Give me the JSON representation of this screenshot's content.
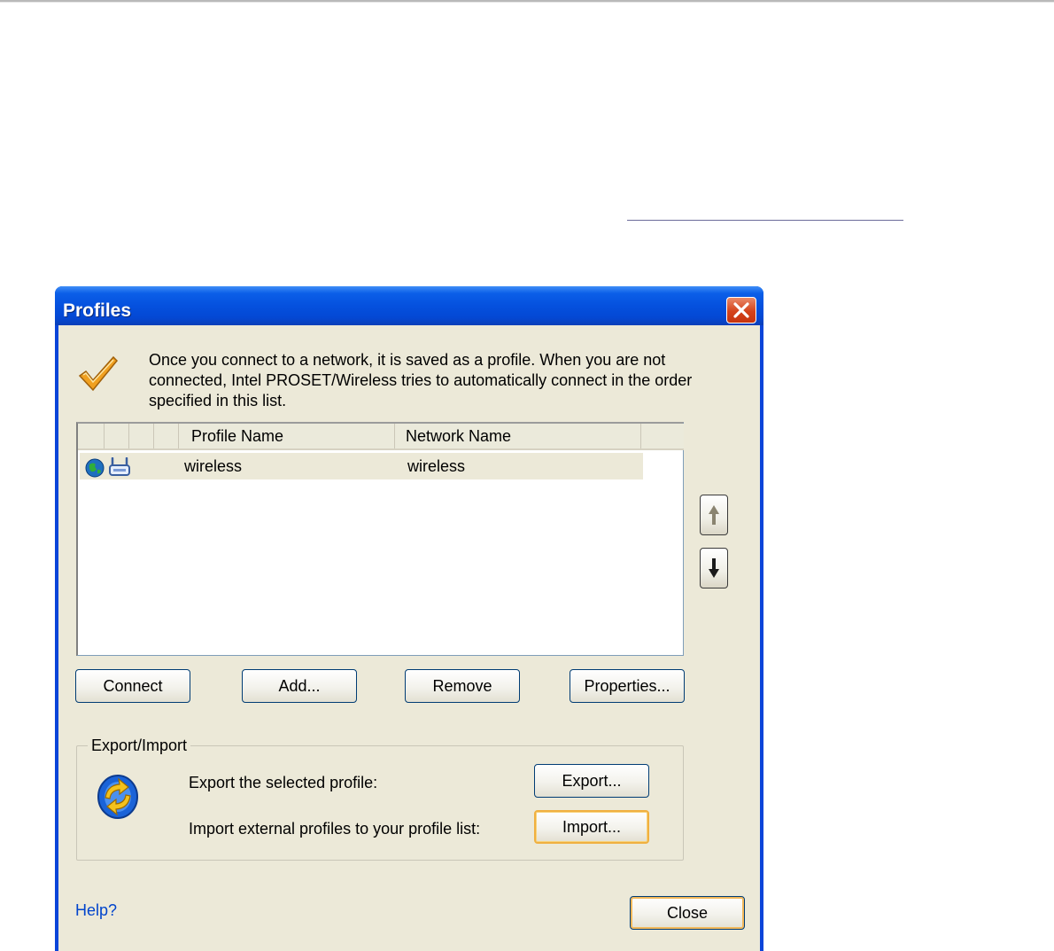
{
  "window": {
    "title": "Profiles",
    "intro_text": "Once you connect to a network, it is saved as a profile. When you are not connected, Intel PROSET/Wireless tries to automatically connect in the order specified in this list."
  },
  "profile_list": {
    "columns": [
      "Profile Name",
      "Network Name"
    ],
    "rows": [
      {
        "profile_name": "wireless",
        "network_name": "wireless"
      }
    ]
  },
  "buttons": {
    "connect": "Connect",
    "add": "Add...",
    "remove": "Remove",
    "properties": "Properties...",
    "export": "Export...",
    "import": "Import...",
    "close": "Close"
  },
  "export_import": {
    "legend": "Export/Import",
    "export_label": "Export the selected profile:",
    "import_label": "Import external profiles to your profile list:"
  },
  "help": {
    "label": "Help?"
  },
  "icons": [
    "checkmark-icon",
    "globe-icon",
    "router-icon",
    "arrow-up-icon",
    "arrow-down-icon",
    "sync-icon",
    "close-icon"
  ],
  "colors": {
    "titlebar": "#0551de",
    "client": "#ece9d8",
    "close": "#d4431b",
    "link": "#0044cc"
  }
}
